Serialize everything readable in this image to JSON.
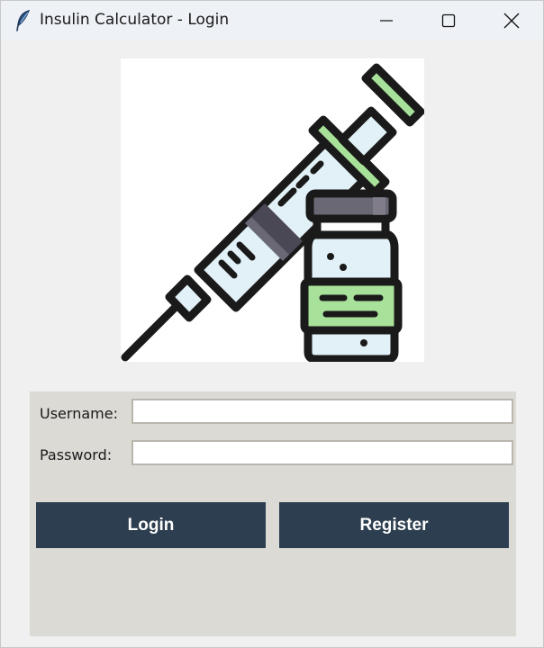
{
  "window": {
    "title": "Insulin Calculator - Login",
    "controls": {
      "minimize": "minimize-icon",
      "maximize": "maximize-icon",
      "close": "close-icon"
    }
  },
  "logo": {
    "icon": "syringe-and-vial-icon"
  },
  "form": {
    "username_label": "Username:",
    "username_value": "",
    "password_label": "Password:",
    "password_value": ""
  },
  "buttons": {
    "login": "Login",
    "register": "Register"
  },
  "colors": {
    "button_bg": "#2c3e50",
    "button_text": "#ffffff",
    "panel_bg": "#dcdad5",
    "window_bg": "#f0f0f0",
    "titlebar_bg": "#eef1f6",
    "syringe_green": "#a8e29a",
    "syringe_barrel": "#e2f1f7",
    "vial_cap": "#6b6875"
  }
}
